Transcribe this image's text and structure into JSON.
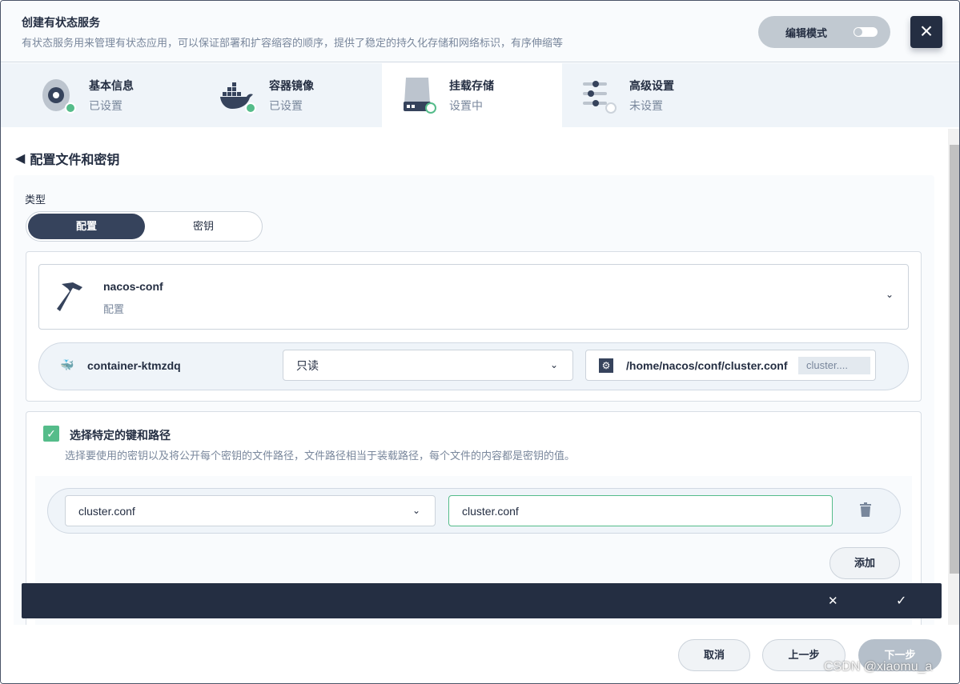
{
  "header": {
    "title": "创建有状态服务",
    "description": "有状态服务用来管理有状态应用，可以保证部署和扩容缩容的顺序，提供了稳定的持久化存储和网络标识，有序伸缩等",
    "edit_mode_label": "编辑模式",
    "close_icon": "×"
  },
  "steps": [
    {
      "title": "基本信息",
      "status": "已设置",
      "icon": "disc-icon",
      "state": "done"
    },
    {
      "title": "容器镜像",
      "status": "已设置",
      "icon": "docker-icon",
      "state": "done"
    },
    {
      "title": "挂载存储",
      "status": "设置中",
      "icon": "storage-icon",
      "state": "active"
    },
    {
      "title": "高级设置",
      "status": "未设置",
      "icon": "sliders-icon",
      "state": "pending"
    }
  ],
  "section": {
    "title": "配置文件和密钥",
    "type_label": "类型",
    "type_options": [
      "配置",
      "密钥"
    ],
    "type_selected": "配置"
  },
  "resource": {
    "name": "nacos-conf",
    "kind": "配置"
  },
  "mount": {
    "container": "container-ktmzdq",
    "access_mode": "只读",
    "path": "/home/nacos/conf/cluster.conf",
    "sub_path": "cluster...."
  },
  "keys": {
    "checkbox_label": "选择特定的键和路径",
    "checked": true,
    "description": "选择要使用的密钥以及将公开每个密钥的文件路径，文件路径相当于装载路径，每个文件的内容都是密钥的值。",
    "items": [
      {
        "key": "cluster.conf",
        "path": "cluster.conf"
      }
    ],
    "add_label": "添加"
  },
  "confirm_bar": {
    "cancel_icon": "✕",
    "confirm_icon": "✓"
  },
  "footer": {
    "cancel": "取消",
    "prev": "上一步",
    "next": "下一步"
  },
  "watermark": "CSDN @xiaomu_a",
  "colors": {
    "primary": "#242e42",
    "success": "#55bc8a",
    "panel": "#f9fbfd"
  }
}
